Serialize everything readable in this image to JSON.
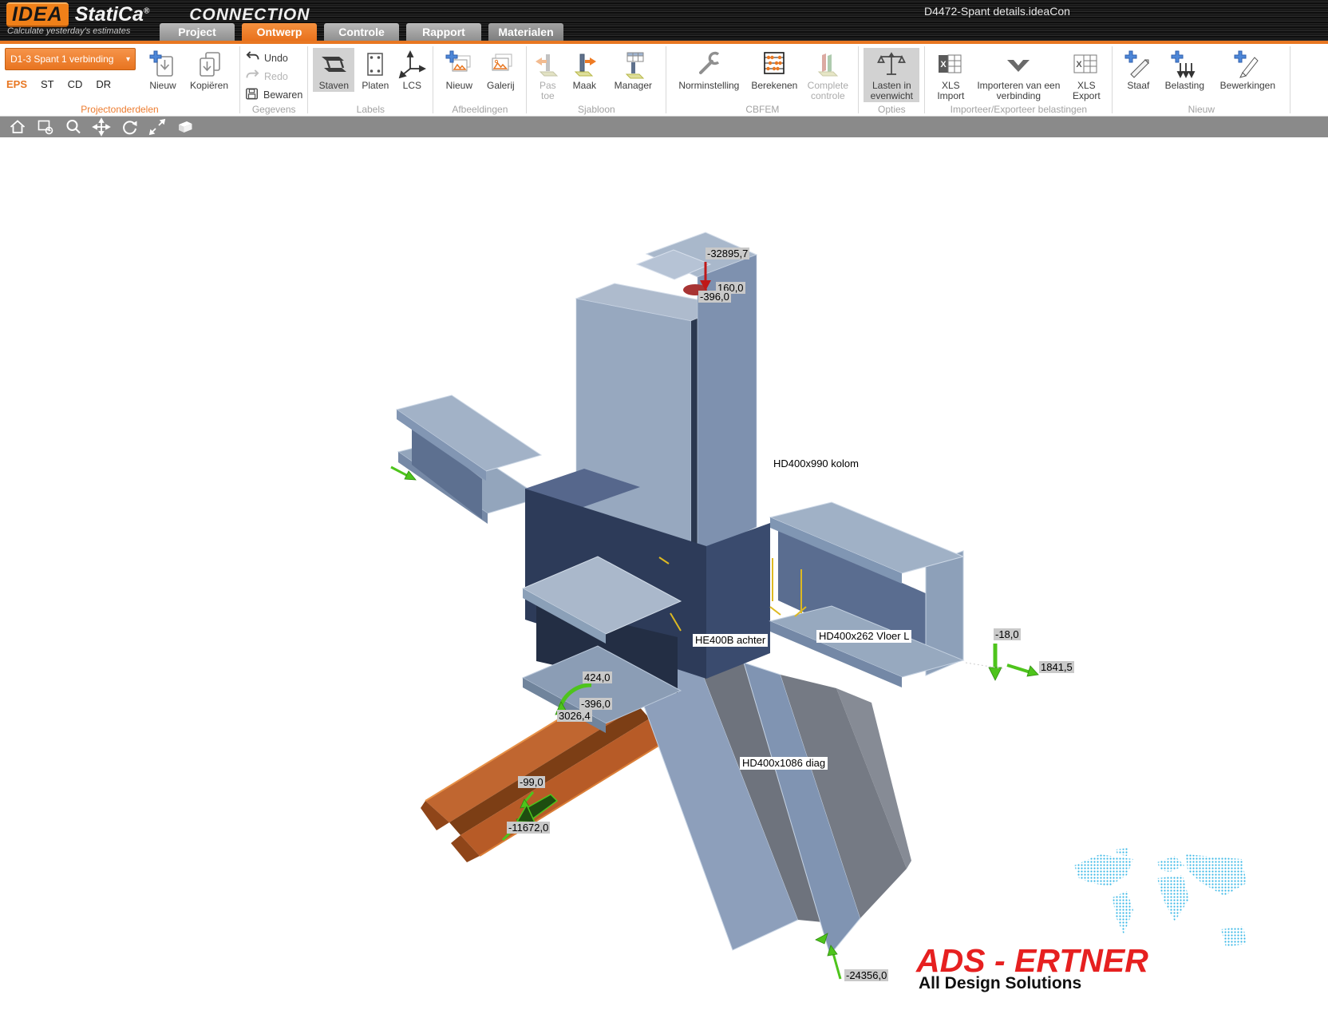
{
  "app": {
    "logo_text": "IDEA",
    "brand": "StatiCa",
    "brand_mark": "®",
    "product": "CONNECTION",
    "tagline": "Calculate yesterday's estimates",
    "document_title": "D4472-Spant details.ideaCon"
  },
  "icons": {
    "chevron_down": "▾"
  },
  "tabs": [
    {
      "label": "Project"
    },
    {
      "label": "Ontwerp"
    },
    {
      "label": "Controle"
    },
    {
      "label": "Rapport"
    },
    {
      "label": "Materialen"
    }
  ],
  "project_panel": {
    "dropdown_value": "D1-3 Spant 1 verbinding",
    "modes": [
      "EPS",
      "ST",
      "CD",
      "DR"
    ]
  },
  "ribbon": {
    "groups": [
      {
        "label": "Projectonderdelen",
        "buttons": [
          {
            "label": "Nieuw"
          },
          {
            "label": "Kopiëren"
          }
        ]
      },
      {
        "label": "Gegevens",
        "buttons": [
          {
            "label": "Undo"
          },
          {
            "label": "Redo"
          },
          {
            "label": "Bewaren"
          }
        ]
      },
      {
        "label": "Labels",
        "buttons": [
          {
            "label": "Staven"
          },
          {
            "label": "Platen"
          },
          {
            "label": "LCS"
          }
        ]
      },
      {
        "label": "Afbeeldingen",
        "buttons": [
          {
            "label": "Nieuw"
          },
          {
            "label": "Galerij"
          }
        ]
      },
      {
        "label": "Sjabloon",
        "buttons": [
          {
            "label": "Pas toe"
          },
          {
            "label": "Maak"
          },
          {
            "label": "Manager"
          }
        ]
      },
      {
        "label": "CBFEM",
        "buttons": [
          {
            "label": "Norminstelling"
          },
          {
            "label": "Berekenen"
          },
          {
            "label": "Complete controle"
          }
        ]
      },
      {
        "label": "Opties",
        "buttons": [
          {
            "label": "Lasten in evenwicht"
          }
        ]
      },
      {
        "label": "Importeer/Exporteer belastingen",
        "buttons": [
          {
            "label": "XLS Import"
          },
          {
            "label": "Importeren van een verbinding"
          },
          {
            "label": "XLS Export"
          }
        ]
      },
      {
        "label": "Nieuw",
        "buttons": [
          {
            "label": "Staaf"
          },
          {
            "label": "Belasting"
          },
          {
            "label": "Bewerkingen"
          }
        ]
      }
    ]
  },
  "viewport": {
    "member_labels": [
      {
        "text": "HD400x990 kolom"
      },
      {
        "text": "HE400B achter"
      },
      {
        "text": "HD400x262 Vloer L"
      },
      {
        "text": "HD400x1086 diag"
      }
    ],
    "load_labels": [
      {
        "text": "-32895,7"
      },
      {
        "text": "160,0"
      },
      {
        "text": "-396,0"
      },
      {
        "text": "424,0"
      },
      {
        "text": "-396,0"
      },
      {
        "text": "3026,4"
      },
      {
        "text": "-99,0"
      },
      {
        "text": "-11672,0"
      },
      {
        "text": "-18,0"
      },
      {
        "text": "1841,5"
      },
      {
        "text": "-24356,0"
      }
    ],
    "watermark": {
      "title": "ADS - ERTNER",
      "subtitle": "All Design Solutions",
      "title_color": "#e62020",
      "map_color": "#3ab8e6"
    }
  }
}
